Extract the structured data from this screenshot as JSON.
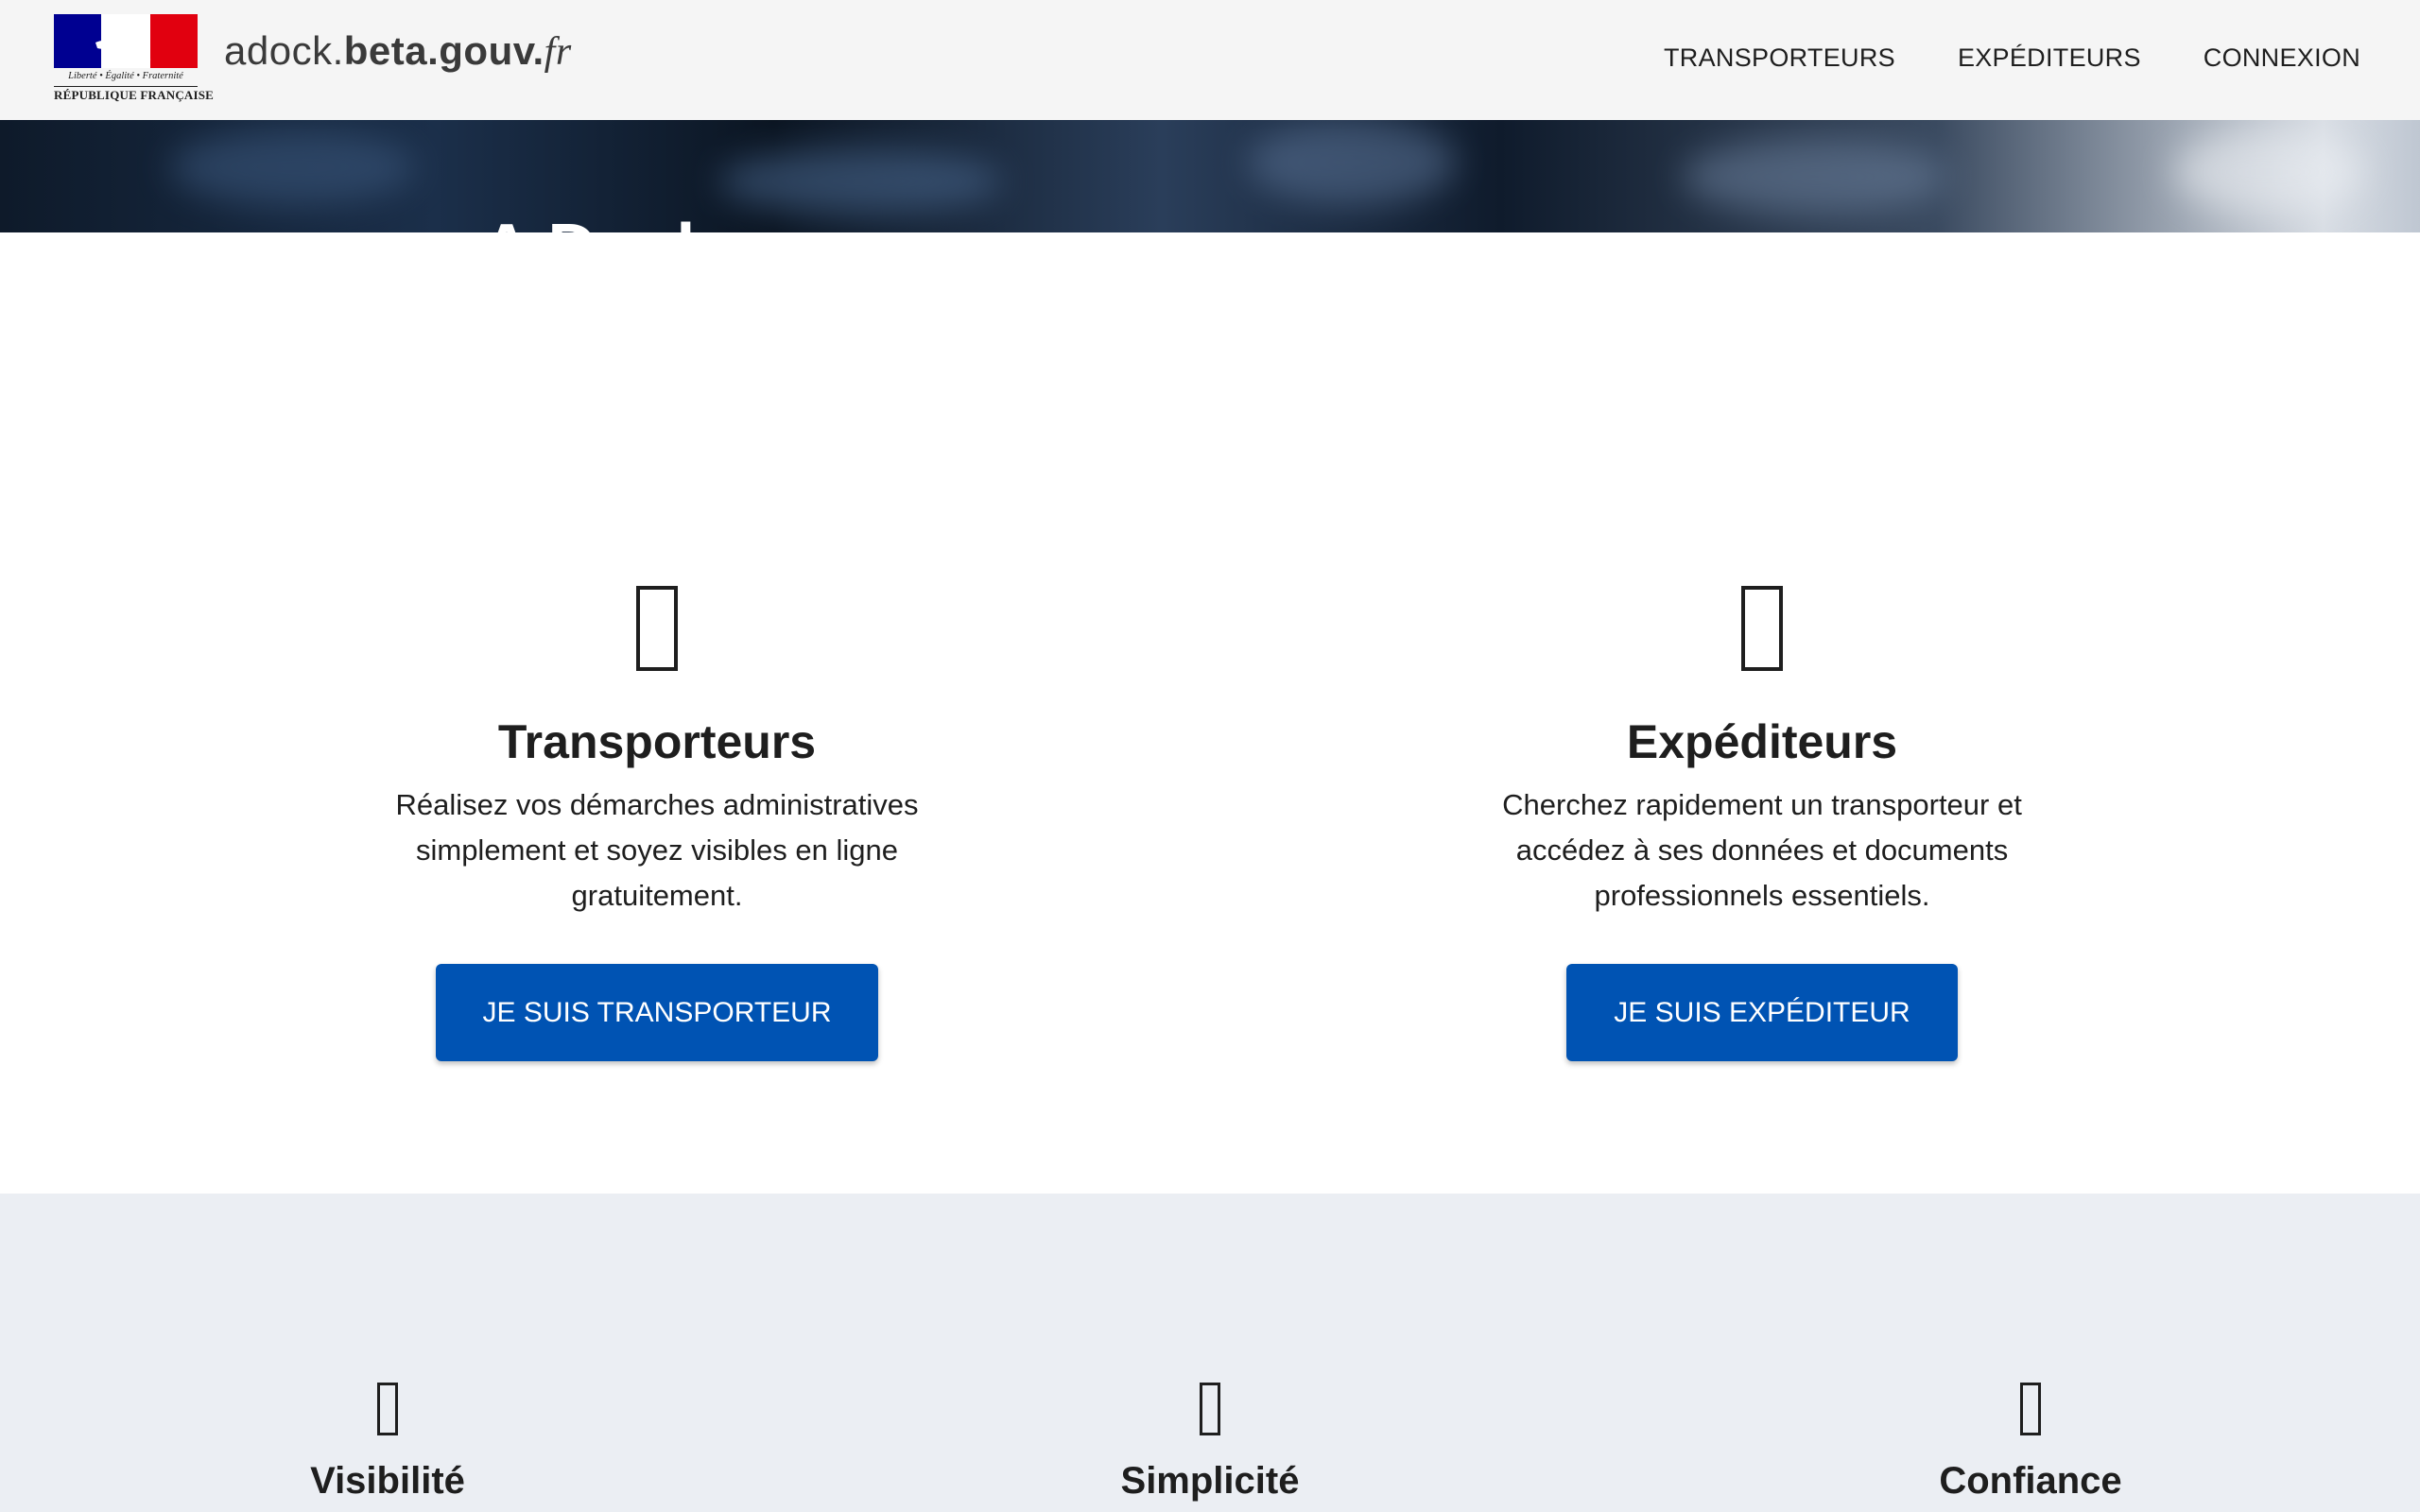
{
  "header": {
    "logo": {
      "motto": "Liberté • Égalité • Fraternité",
      "republic": "RÉPUBLIQUE FRANÇAISE"
    },
    "brand": {
      "part1": "adock.",
      "part2": "beta",
      "part3": ".gouv.",
      "part4": "fr"
    },
    "nav": [
      {
        "label": "TRANSPORTEURS"
      },
      {
        "label": "EXPÉDITEURS"
      },
      {
        "label": "CONNEXION"
      }
    ]
  },
  "hero": {
    "title": "A Dock"
  },
  "audience": [
    {
      "icon": "truck-icon",
      "title": "Transporteurs",
      "text": "Réalisez vos démarches administratives simplement et soyez visibles en ligne gratuitement.",
      "button": "JE SUIS TRANSPORTEUR"
    },
    {
      "icon": "box-icon",
      "title": "Expéditeurs",
      "text": "Cherchez rapidement un transporteur et accédez à ses données et documents professionnels essentiels.",
      "button": "JE SUIS EXPÉDITEUR"
    }
  ],
  "features": [
    {
      "icon": "eye-icon",
      "title": "Visibilité"
    },
    {
      "icon": "check-icon",
      "title": "Simplicité"
    },
    {
      "icon": "shield-icon",
      "title": "Confiance"
    }
  ],
  "colors": {
    "header_bg": "#f5f5f5",
    "button_bg": "#0053b3",
    "features_bg": "#ebeef3",
    "flag_blue": "#000091",
    "flag_red": "#e1000f"
  }
}
